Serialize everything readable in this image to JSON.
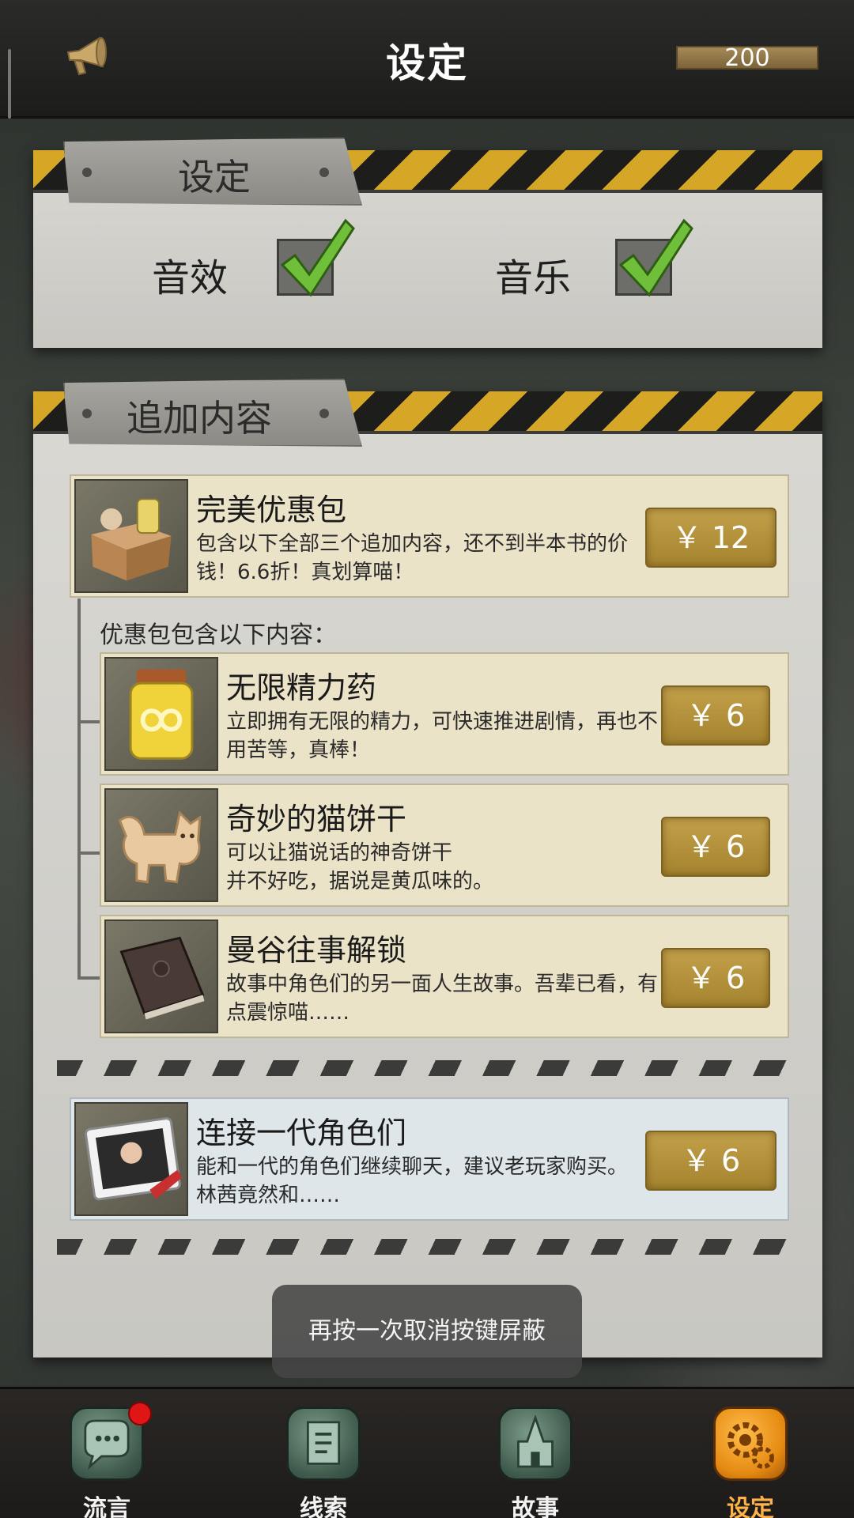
{
  "header": {
    "title": "设定",
    "score": "200",
    "megaphone_icon": "megaphone-icon"
  },
  "settings_panel": {
    "heading": "设定",
    "sound_effects": {
      "label": "音效",
      "checked": true
    },
    "music": {
      "label": "音乐",
      "checked": true
    }
  },
  "addons_panel": {
    "heading": "追加内容",
    "bundle": {
      "title": "完美优惠包",
      "desc": "包含以下全部三个追加内容，还不到半本书的价钱！6.6折！真划算喵！",
      "price": "￥ 12"
    },
    "bundle_contents_label": "优惠包包含以下内容：",
    "items": [
      {
        "title": "无限精力药",
        "desc": "立即拥有无限的精力，可快速推进剧情，再也不用苦等，真棒！",
        "price": "￥ 6"
      },
      {
        "title": "奇妙的猫饼干",
        "desc": "可以让猫说话的神奇饼干\n并不好吃，据说是黄瓜味的。",
        "price": "￥ 6"
      },
      {
        "title": "曼谷往事解锁",
        "desc": "故事中角色们的另一面人生故事。吾辈已看，有点震惊喵……",
        "price": "￥ 6"
      }
    ],
    "legacy": {
      "title": "连接一代角色们",
      "desc": "能和一代的角色们继续聊天，建议老玩家购买。林茜竟然和……",
      "price": "￥ 6"
    }
  },
  "toast": "再按一次取消按键屏蔽",
  "bottom_nav": [
    {
      "label": "流言",
      "icon": "rumor-chat-icon",
      "has_badge": true,
      "active": false
    },
    {
      "label": "线索",
      "icon": "clue-scroll-icon",
      "has_badge": false,
      "active": false
    },
    {
      "label": "故事",
      "icon": "story-castle-icon",
      "has_badge": false,
      "active": false
    },
    {
      "label": "设定",
      "icon": "settings-gear-icon",
      "has_badge": false,
      "active": true
    }
  ],
  "colors": {
    "hazard_yellow": "#d6a727",
    "price_gold": "#b8963f",
    "active_tab": "#ffb24a",
    "badge_red": "#e01515"
  }
}
